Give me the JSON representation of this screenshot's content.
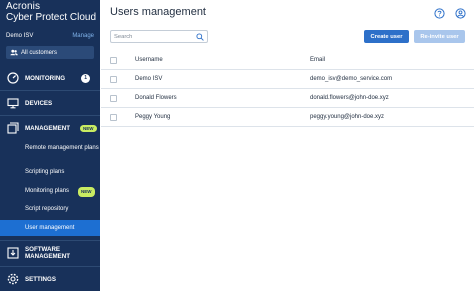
{
  "brand": {
    "line1": "Acronis",
    "line2": "Cyber Protect Cloud"
  },
  "tenant": {
    "name": "Demo ISV",
    "manage_label": "Manage"
  },
  "customer_select": {
    "value": "All customers"
  },
  "nav": {
    "monitoring": {
      "label": "MONITORING",
      "badge": "1"
    },
    "devices": {
      "label": "DEVICES"
    },
    "management": {
      "label": "MANAGEMENT",
      "badge": "NEW"
    },
    "sub": [
      {
        "label": "Remote management plans"
      },
      {
        "label": "Scripting plans"
      },
      {
        "label": "Monitoring plans",
        "badge": "NEW"
      },
      {
        "label": "Script repository"
      },
      {
        "label": "User management"
      }
    ],
    "software_management": {
      "label": "SOFTWARE MANAGEMENT"
    },
    "settings": {
      "label": "SETTINGS"
    }
  },
  "main": {
    "title": "Users management",
    "search_placeholder": "Search",
    "create_label": "Create user",
    "reinvite_label": "Re-invite user"
  },
  "table": {
    "columns": [
      "Username",
      "Email"
    ],
    "rows": [
      {
        "username": "Demo ISV",
        "email": "demo_isv@demo_service.com"
      },
      {
        "username": "Donald Flowers",
        "email": "donald.flowers@john-doe.xyz"
      },
      {
        "username": "Peggy Young",
        "email": "peggy.young@john-doe.xyz"
      }
    ]
  },
  "colors": {
    "sidebar": "#18315a",
    "accent": "#2d70c9",
    "selected": "#1d6fd2",
    "badge_new": "#c9ec62"
  }
}
